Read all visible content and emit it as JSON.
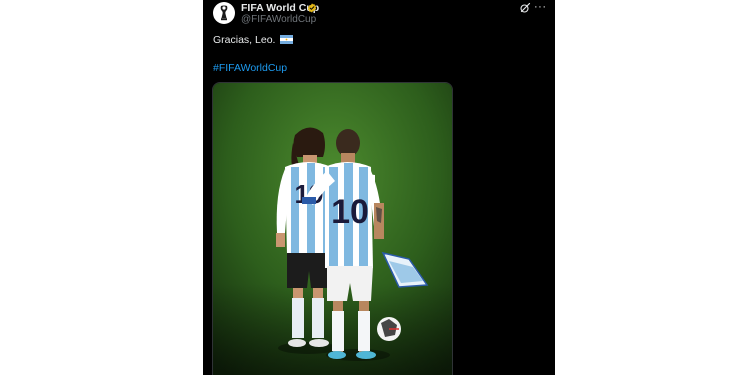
{
  "post": {
    "author": {
      "display_name": "FIFA World Cup",
      "handle": "@FIFAWorldCup",
      "verified": true,
      "avatar_icon": "world-cup-trophy-logo"
    },
    "text": "Gracias, Leo.",
    "text_emoji": "argentina-flag",
    "hashtag": "#FIFAWorldCup",
    "media": {
      "type": "image",
      "jersey_numbers": [
        "19",
        "10"
      ]
    },
    "actions": {
      "grok_icon": "grok-icon",
      "more_icon": "more-icon",
      "more_label": "···"
    }
  },
  "colors": {
    "background": "#000000",
    "text": "#e7e9ea",
    "secondary_text": "#71767b",
    "link": "#1d9bf0",
    "verified": "#e2b719"
  }
}
